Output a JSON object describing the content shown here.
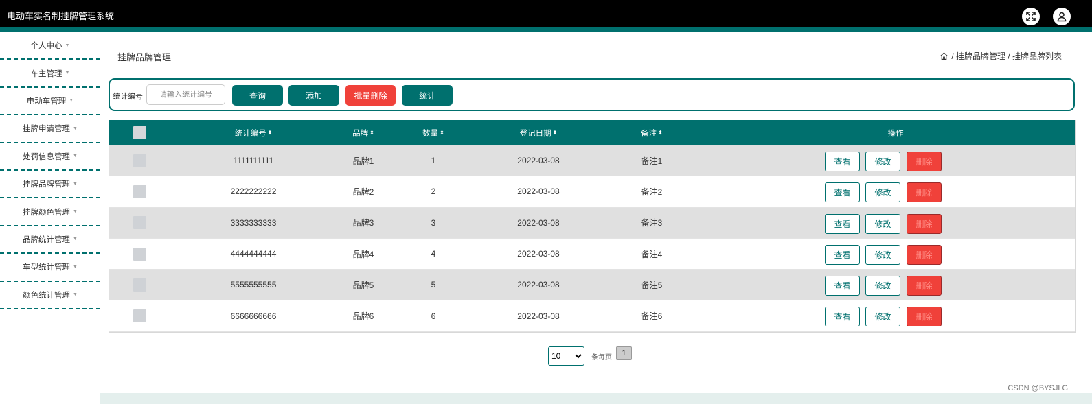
{
  "app": {
    "title": "电动车实名制挂牌管理系统"
  },
  "header_icons": {
    "fullscreen": "fullscreen-icon",
    "user": "user-icon"
  },
  "sidebar": {
    "items": [
      {
        "label": "个人中心"
      },
      {
        "label": "车主管理"
      },
      {
        "label": "电动车管理"
      },
      {
        "label": "挂牌申请管理"
      },
      {
        "label": "处罚信息管理"
      },
      {
        "label": "挂牌品牌管理"
      },
      {
        "label": "挂牌颜色管理"
      },
      {
        "label": "品牌统计管理"
      },
      {
        "label": "车型统计管理"
      },
      {
        "label": "颜色统计管理"
      }
    ]
  },
  "page": {
    "title": "挂牌品牌管理"
  },
  "breadcrumb": {
    "text": "/ 挂牌品牌管理 / 挂牌品牌列表"
  },
  "search": {
    "label": "统计编号",
    "placeholder": "请输入统计编号",
    "query": "查询",
    "add": "添加",
    "batch_delete": "批量删除",
    "stats": "统计"
  },
  "table": {
    "headers": {
      "code": "统计编号",
      "brand": "品牌",
      "qty": "数量",
      "date": "登记日期",
      "note": "备注",
      "ops": "操作"
    },
    "rows": [
      {
        "code": "1111111111",
        "brand": "品牌1",
        "qty": "1",
        "date": "2022-03-08",
        "note": "备注1"
      },
      {
        "code": "2222222222",
        "brand": "品牌2",
        "qty": "2",
        "date": "2022-03-08",
        "note": "备注2"
      },
      {
        "code": "3333333333",
        "brand": "品牌3",
        "qty": "3",
        "date": "2022-03-08",
        "note": "备注3"
      },
      {
        "code": "4444444444",
        "brand": "品牌4",
        "qty": "4",
        "date": "2022-03-08",
        "note": "备注4"
      },
      {
        "code": "5555555555",
        "brand": "品牌5",
        "qty": "5",
        "date": "2022-03-08",
        "note": "备注5"
      },
      {
        "code": "6666666666",
        "brand": "品牌6",
        "qty": "6",
        "date": "2022-03-08",
        "note": "备注6"
      }
    ],
    "actions": {
      "view": "查看",
      "edit": "修改",
      "delete": "删除"
    }
  },
  "pagination": {
    "page_size": "10",
    "page_size_label": "条每页",
    "current_page": "1"
  },
  "watermark": "CSDN @BYSJLG",
  "colors": {
    "primary": "#00706e",
    "danger": "#f0413a",
    "topbar": "#000000"
  }
}
